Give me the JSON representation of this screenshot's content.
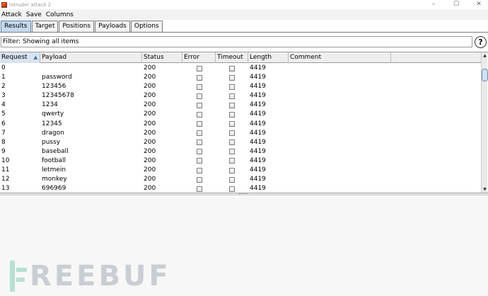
{
  "window": {
    "title": "Intruder attack 2",
    "min": "–",
    "max": "☐",
    "close": "✕"
  },
  "menu": [
    "Attack",
    "Save",
    "Columns"
  ],
  "tabs": [
    {
      "label": "Results",
      "active": true
    },
    {
      "label": "Target",
      "active": false
    },
    {
      "label": "Positions",
      "active": false
    },
    {
      "label": "Payloads",
      "active": false
    },
    {
      "label": "Options",
      "active": false
    }
  ],
  "filter": {
    "text": "Filter: Showing all items",
    "help": "?"
  },
  "table": {
    "columns": [
      "Request",
      "Payload",
      "Status",
      "Error",
      "Timeout",
      "Length",
      "Comment"
    ],
    "sort_column": "Request",
    "sort_arrow": "▲",
    "rows": [
      {
        "request": "0",
        "payload": "",
        "status": "200",
        "error": false,
        "timeout": false,
        "length": "4419",
        "comment": ""
      },
      {
        "request": "1",
        "payload": "password",
        "status": "200",
        "error": false,
        "timeout": false,
        "length": "4419",
        "comment": ""
      },
      {
        "request": "2",
        "payload": "123456",
        "status": "200",
        "error": false,
        "timeout": false,
        "length": "4419",
        "comment": ""
      },
      {
        "request": "3",
        "payload": "12345678",
        "status": "200",
        "error": false,
        "timeout": false,
        "length": "4419",
        "comment": ""
      },
      {
        "request": "4",
        "payload": "1234",
        "status": "200",
        "error": false,
        "timeout": false,
        "length": "4419",
        "comment": ""
      },
      {
        "request": "5",
        "payload": "qwerty",
        "status": "200",
        "error": false,
        "timeout": false,
        "length": "4419",
        "comment": ""
      },
      {
        "request": "6",
        "payload": "12345",
        "status": "200",
        "error": false,
        "timeout": false,
        "length": "4419",
        "comment": ""
      },
      {
        "request": "7",
        "payload": "dragon",
        "status": "200",
        "error": false,
        "timeout": false,
        "length": "4419",
        "comment": ""
      },
      {
        "request": "8",
        "payload": "pussy",
        "status": "200",
        "error": false,
        "timeout": false,
        "length": "4419",
        "comment": ""
      },
      {
        "request": "9",
        "payload": "baseball",
        "status": "200",
        "error": false,
        "timeout": false,
        "length": "4419",
        "comment": ""
      },
      {
        "request": "10",
        "payload": "football",
        "status": "200",
        "error": false,
        "timeout": false,
        "length": "4419",
        "comment": ""
      },
      {
        "request": "11",
        "payload": "letmein",
        "status": "200",
        "error": false,
        "timeout": false,
        "length": "4419",
        "comment": ""
      },
      {
        "request": "12",
        "payload": "monkey",
        "status": "200",
        "error": false,
        "timeout": false,
        "length": "4419",
        "comment": ""
      },
      {
        "request": "13",
        "payload": "696969",
        "status": "200",
        "error": false,
        "timeout": false,
        "length": "4419",
        "comment": ""
      }
    ]
  },
  "scroll": {
    "up": "▲",
    "down": "▼"
  },
  "watermark": {
    "text": "REEBUF"
  },
  "colors": {
    "active_tab": "#c5d9ee",
    "sorted_header": "#d7e3f1",
    "watermark": "#b8e0d4"
  }
}
